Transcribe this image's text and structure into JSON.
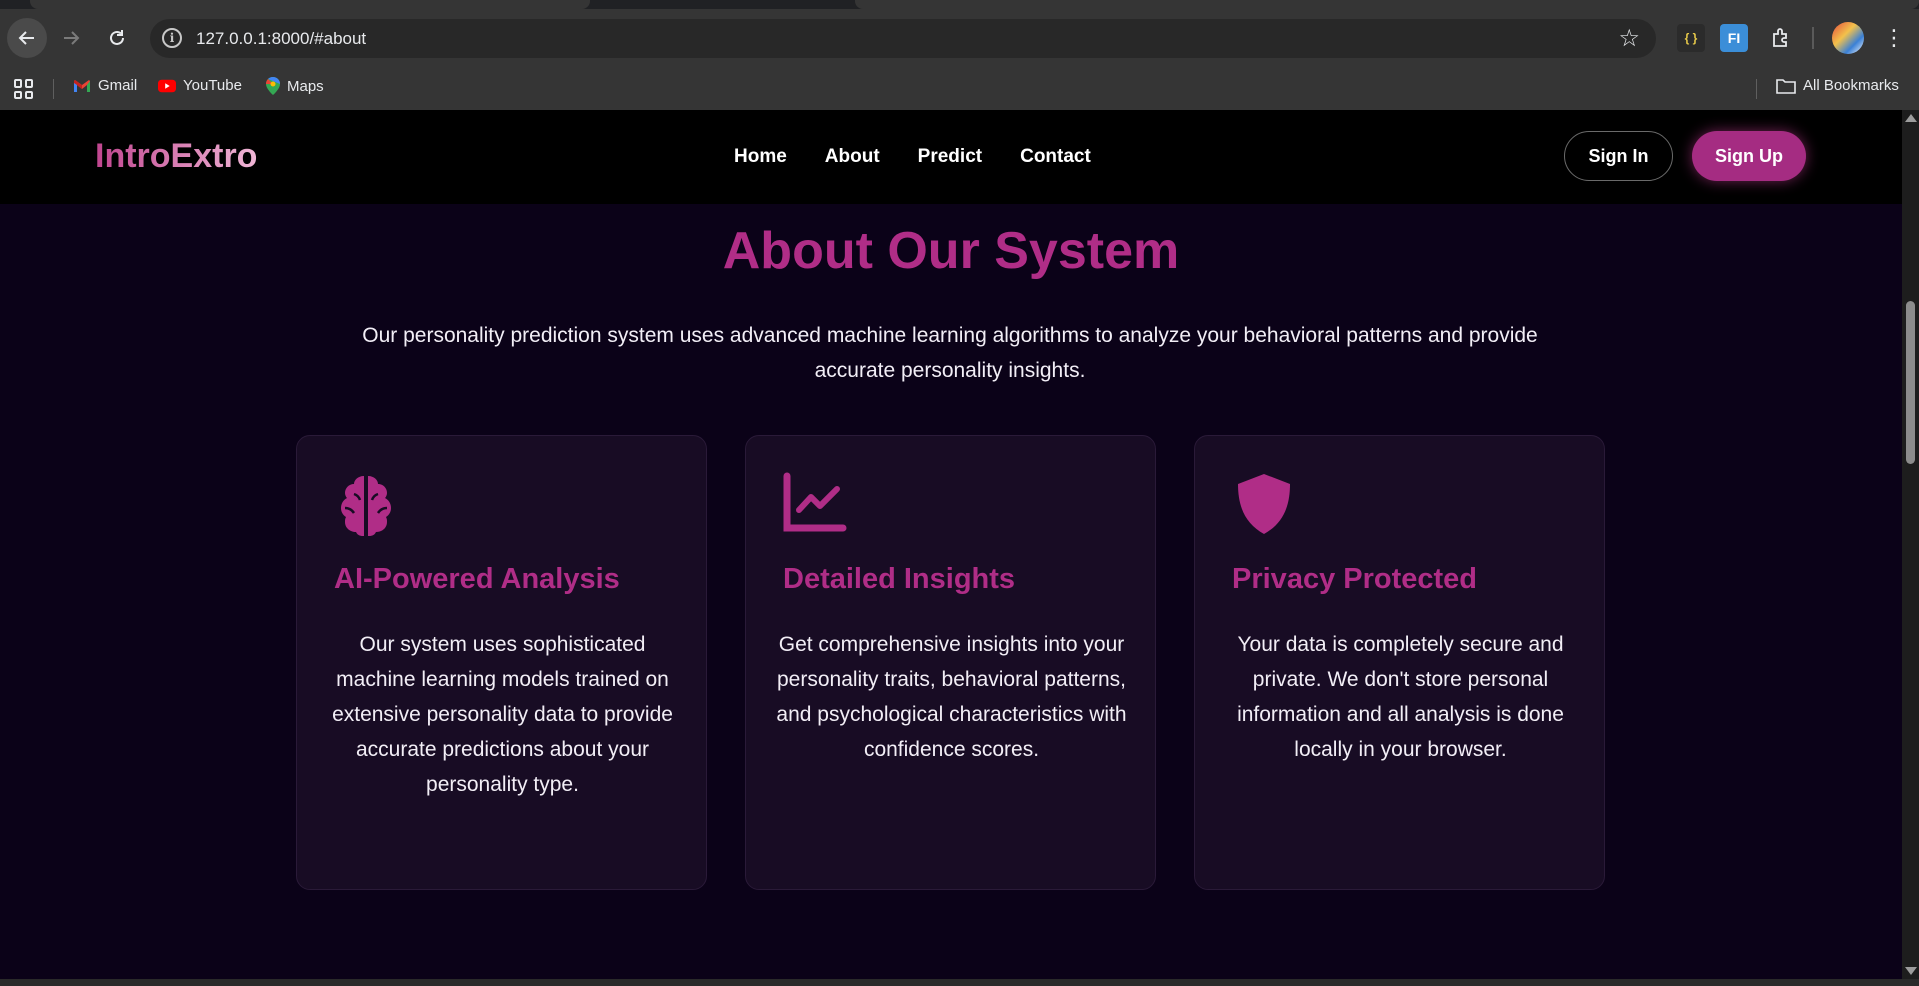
{
  "browser": {
    "url": "127.0.0.1:8000/#about",
    "bookmarks": [
      {
        "label": "Gmail",
        "icon": "gmail-icon"
      },
      {
        "label": "YouTube",
        "icon": "youtube-icon"
      },
      {
        "label": "Maps",
        "icon": "maps-icon"
      }
    ],
    "all_bookmarks_label": "All Bookmarks",
    "extensions": {
      "json_label": "{ }",
      "fi_label": "FI"
    }
  },
  "site": {
    "logo": "IntroExtro",
    "nav": [
      "Home",
      "About",
      "Predict",
      "Contact"
    ],
    "signin_label": "Sign In",
    "signup_label": "Sign Up"
  },
  "about": {
    "title": "About Our System",
    "description": "Our personality prediction system uses advanced machine learning algorithms to analyze your behavioral patterns and provide accurate personality insights.",
    "cards": [
      {
        "icon": "brain-icon",
        "title": "AI-Powered Analysis",
        "text": "Our system uses sophisticated machine learning models trained on extensive personality data to provide accurate predictions about your personality type."
      },
      {
        "icon": "chart-line-icon",
        "title": "Detailed Insights",
        "text": "Get comprehensive insights into your personality traits, behavioral patterns, and psychological characteristics with confidence scores."
      },
      {
        "icon": "shield-icon",
        "title": "Privacy Protected",
        "text": "Your data is completely secure and private. We don't store personal information and all analysis is done locally in your browser."
      }
    ]
  },
  "colors": {
    "accent": "#b02d87",
    "page_bg": "#0b0218",
    "card_bg": "#180c24",
    "header_bg": "#000000"
  }
}
